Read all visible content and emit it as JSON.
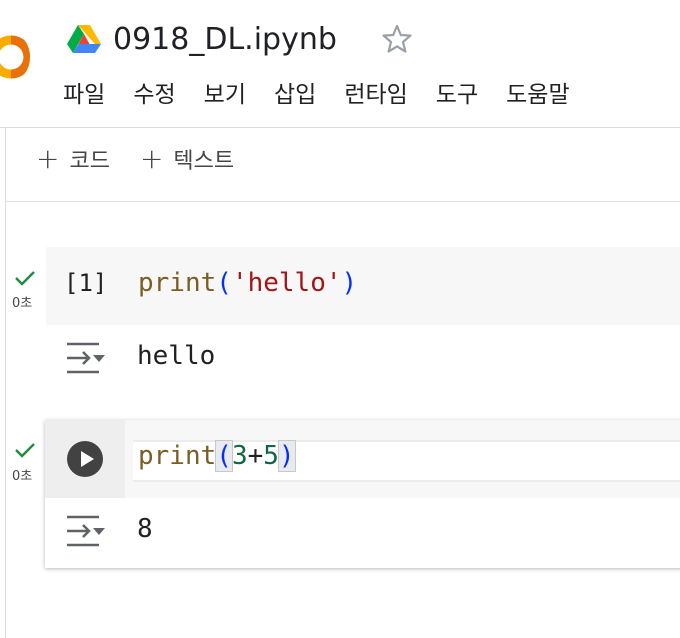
{
  "notebook": {
    "title": "0918_DL.ipynb"
  },
  "menu": {
    "items": [
      "파일",
      "수정",
      "보기",
      "삽입",
      "런타임",
      "도구",
      "도움말"
    ]
  },
  "toolbar": {
    "add_code_label": "코드",
    "add_text_label": "텍스트"
  },
  "cells": [
    {
      "execution_count": "[1]",
      "status": "success",
      "runtime": "0초",
      "code": {
        "func": "print",
        "open": "(",
        "arg": "'hello'",
        "close": ")"
      },
      "output": "hello"
    },
    {
      "execution_count": "",
      "status": "success",
      "runtime": "0초",
      "code": {
        "func": "print",
        "open": "(",
        "arg_left": "3",
        "operator": "+",
        "arg_right": "5",
        "close": ")"
      },
      "output": "8"
    }
  ],
  "colors": {
    "keyword": "#795e26",
    "bracket": "#0431fa",
    "string": "#a31515",
    "number": "#116644",
    "success": "#1e8e3e"
  },
  "icons": {
    "app_logo": "colab-logo",
    "drive": "google-drive-icon",
    "star": "star-outline-icon",
    "run": "play-icon",
    "output": "output-arrow-icon",
    "status": "check-icon"
  }
}
